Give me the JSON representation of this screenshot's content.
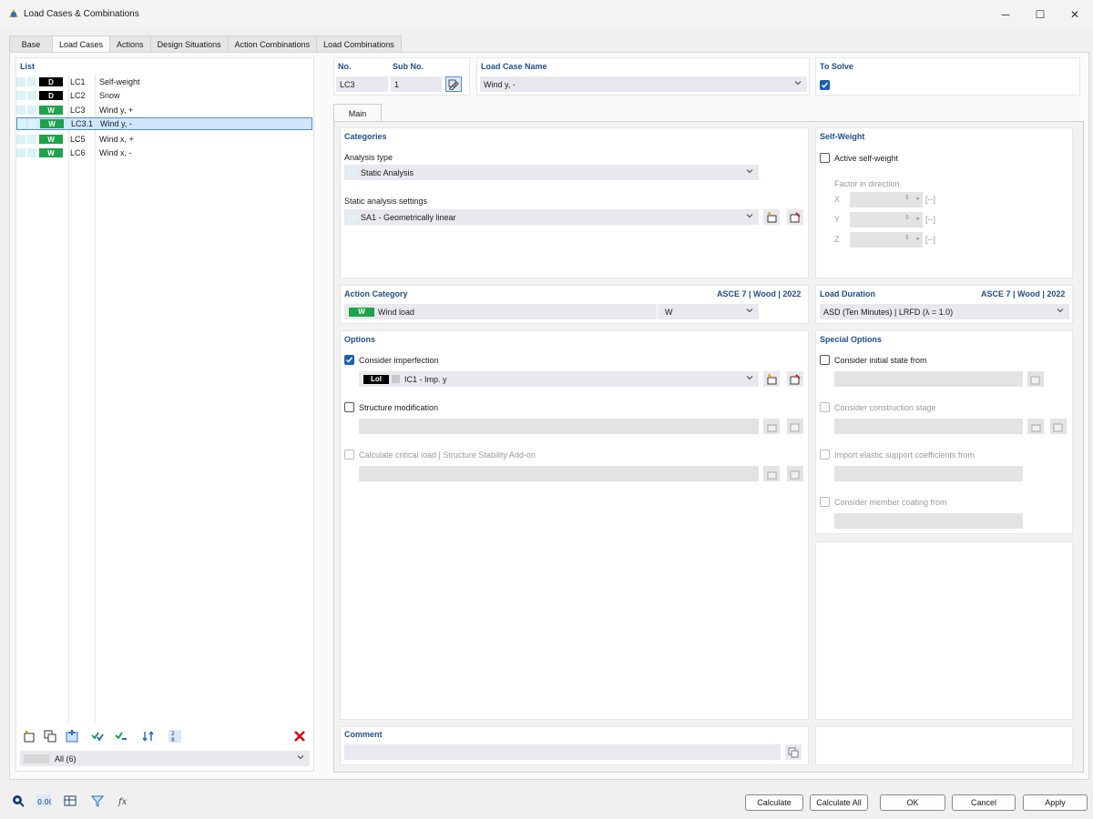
{
  "window": {
    "title": "Load Cases & Combinations"
  },
  "tabs": [
    "Base",
    "Load Cases",
    "Actions",
    "Design Situations",
    "Action Combinations",
    "Load Combinations"
  ],
  "list": {
    "header": "List",
    "items": [
      {
        "type": "D",
        "id": "LC1",
        "name": "Self-weight"
      },
      {
        "type": "D",
        "id": "LC2",
        "name": "Snow"
      },
      {
        "type": "W",
        "id": "LC3",
        "name": "Wind y, +"
      },
      {
        "type": "W",
        "id": "LC3.1",
        "name": "Wind y, -"
      },
      {
        "type": "W",
        "id": "LC5",
        "name": "Wind x, +"
      },
      {
        "type": "W",
        "id": "LC6",
        "name": "Wind x, -"
      }
    ],
    "filter": "All (6)"
  },
  "header": {
    "no_label": "No.",
    "no_value": "LC3",
    "subno_label": "Sub No.",
    "subno_value": "1",
    "name_label": "Load Case Name",
    "name_value": "Wind y, -",
    "tosolve_label": "To Solve"
  },
  "subtab": "Main",
  "categories": {
    "title": "Categories",
    "analysis_label": "Analysis type",
    "analysis_value": "Static Analysis",
    "settings_label": "Static analysis settings",
    "settings_value": "SA1 - Geometrically linear"
  },
  "selfweight": {
    "title": "Self-Weight",
    "active_label": "Active self-weight",
    "factor_label": "Factor in direction",
    "axes": [
      "X",
      "Y",
      "Z"
    ],
    "unit": "[--]"
  },
  "action_category": {
    "title": "Action Category",
    "standard": "ASCE 7 | Wood | 2022",
    "badge": "W",
    "value": "Wind load",
    "code": "W"
  },
  "load_duration": {
    "title": "Load Duration",
    "standard": "ASCE 7 | Wood | 2022",
    "value": "ASD (Ten Minutes) | LRFD (λ = 1.0)"
  },
  "options": {
    "title": "Options",
    "imperfection_label": "Consider imperfection",
    "imperfection_badge": "Lol",
    "imperfection_value": "IC1 - Imp. y",
    "modification_label": "Structure modification",
    "critical_label": "Calculate critical load | Structure Stability Add-on"
  },
  "special": {
    "title": "Special Options",
    "initial_label": "Consider initial state from",
    "construction_label": "Consider construction stage",
    "elastic_label": "Import elastic support coefficients from",
    "coating_label": "Consider member coating from"
  },
  "comment": {
    "label": "Comment"
  },
  "buttons": {
    "calculate": "Calculate",
    "calculate_all": "Calculate All",
    "ok": "OK",
    "cancel": "Cancel",
    "apply": "Apply"
  },
  "colors": {
    "accent": "#1a5fb4",
    "wind": "#1fa34a",
    "dead": "#000000",
    "heading": "#1f4e8c"
  }
}
